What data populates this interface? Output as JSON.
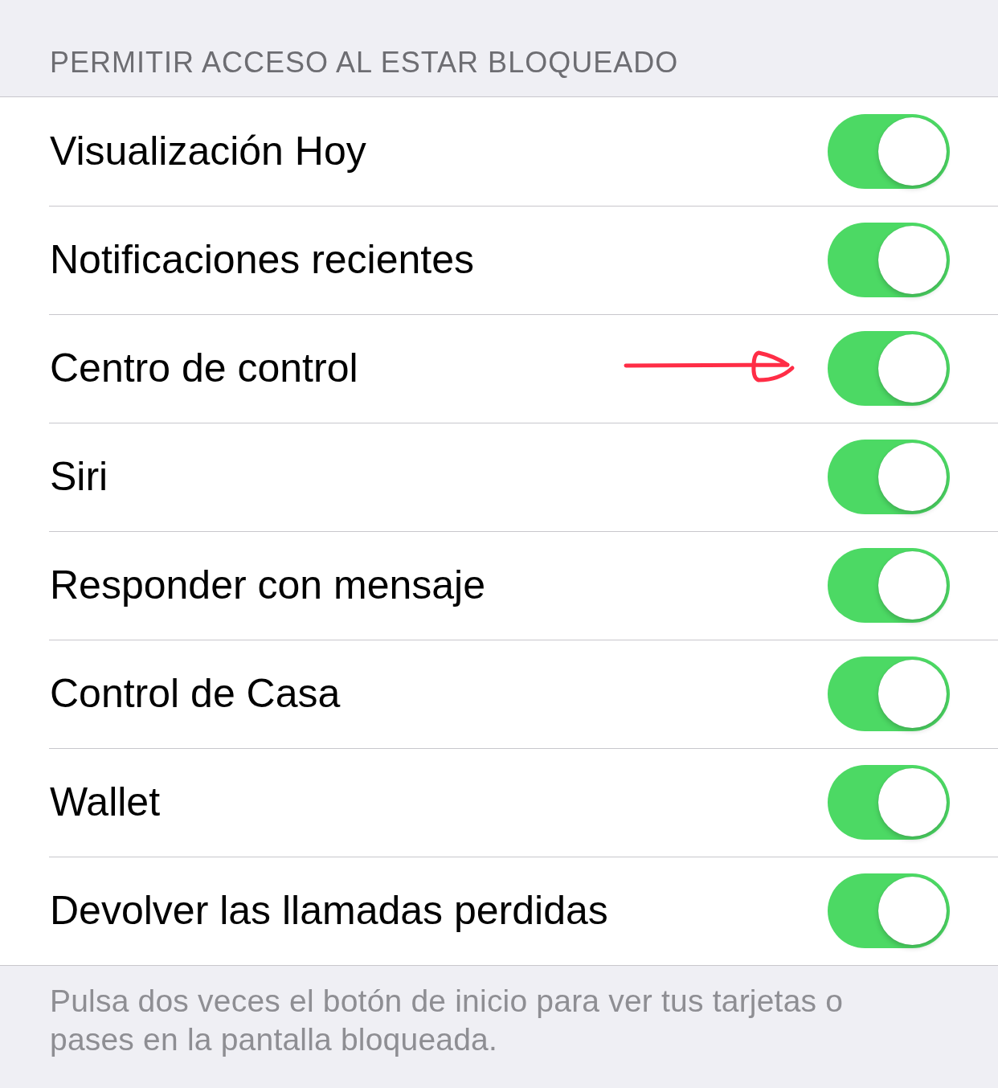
{
  "section": {
    "header": "PERMITIR ACCESO AL ESTAR BLOQUEADO"
  },
  "rows": [
    {
      "label": "Visualización Hoy",
      "on": true,
      "marked": false
    },
    {
      "label": "Notificaciones recientes",
      "on": true,
      "marked": false
    },
    {
      "label": "Centro de control",
      "on": true,
      "marked": true
    },
    {
      "label": "Siri",
      "on": true,
      "marked": false
    },
    {
      "label": "Responder con mensaje",
      "on": true,
      "marked": false
    },
    {
      "label": "Control de Casa",
      "on": true,
      "marked": false
    },
    {
      "label": "Wallet",
      "on": true,
      "marked": false
    },
    {
      "label": "Devolver las llamadas perdidas",
      "on": true,
      "marked": false
    }
  ],
  "footer": "Pulsa dos veces el botón de inicio para ver tus tarjetas o pases en la pantalla bloqueada."
}
